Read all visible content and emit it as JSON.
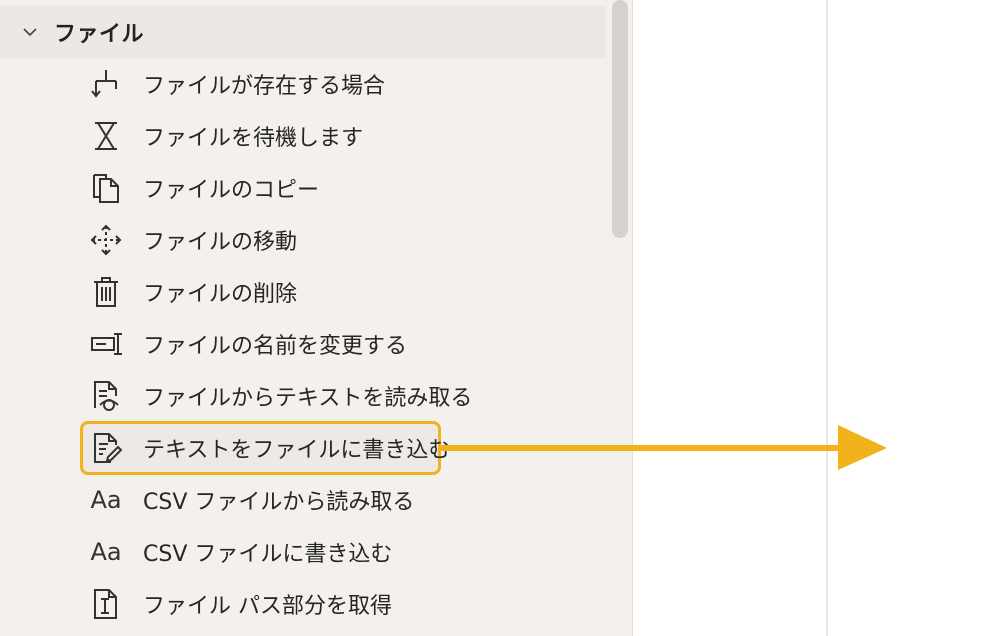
{
  "group": {
    "title": "ファイル",
    "toggle_icon": "chevron-down-icon"
  },
  "items": [
    {
      "label": "ファイルが存在する場合",
      "icon": "branch-icon"
    },
    {
      "label": "ファイルを待機します",
      "icon": "hourglass-icon"
    },
    {
      "label": "ファイルのコピー",
      "icon": "copy-icon"
    },
    {
      "label": "ファイルの移動",
      "icon": "move-icon"
    },
    {
      "label": "ファイルの削除",
      "icon": "trash-icon"
    },
    {
      "label": "ファイルの名前を変更する",
      "icon": "rename-icon"
    },
    {
      "label": "ファイルからテキストを読み取る",
      "icon": "read-file-icon"
    },
    {
      "label": "テキストをファイルに書き込む",
      "icon": "write-file-icon",
      "highlighted": true
    },
    {
      "label": "CSV ファイルから読み取る",
      "icon": "font-aa-icon",
      "icon_text": "Aa"
    },
    {
      "label": "CSV ファイルに書き込む",
      "icon": "font-aa-icon",
      "icon_text": "Aa"
    },
    {
      "label": "ファイル パス部分を取得",
      "icon": "file-path-icon"
    }
  ],
  "colors": {
    "highlight": "#f2b21b",
    "arrow": "#f2b21b",
    "panel_bg": "#f3f0ed"
  }
}
